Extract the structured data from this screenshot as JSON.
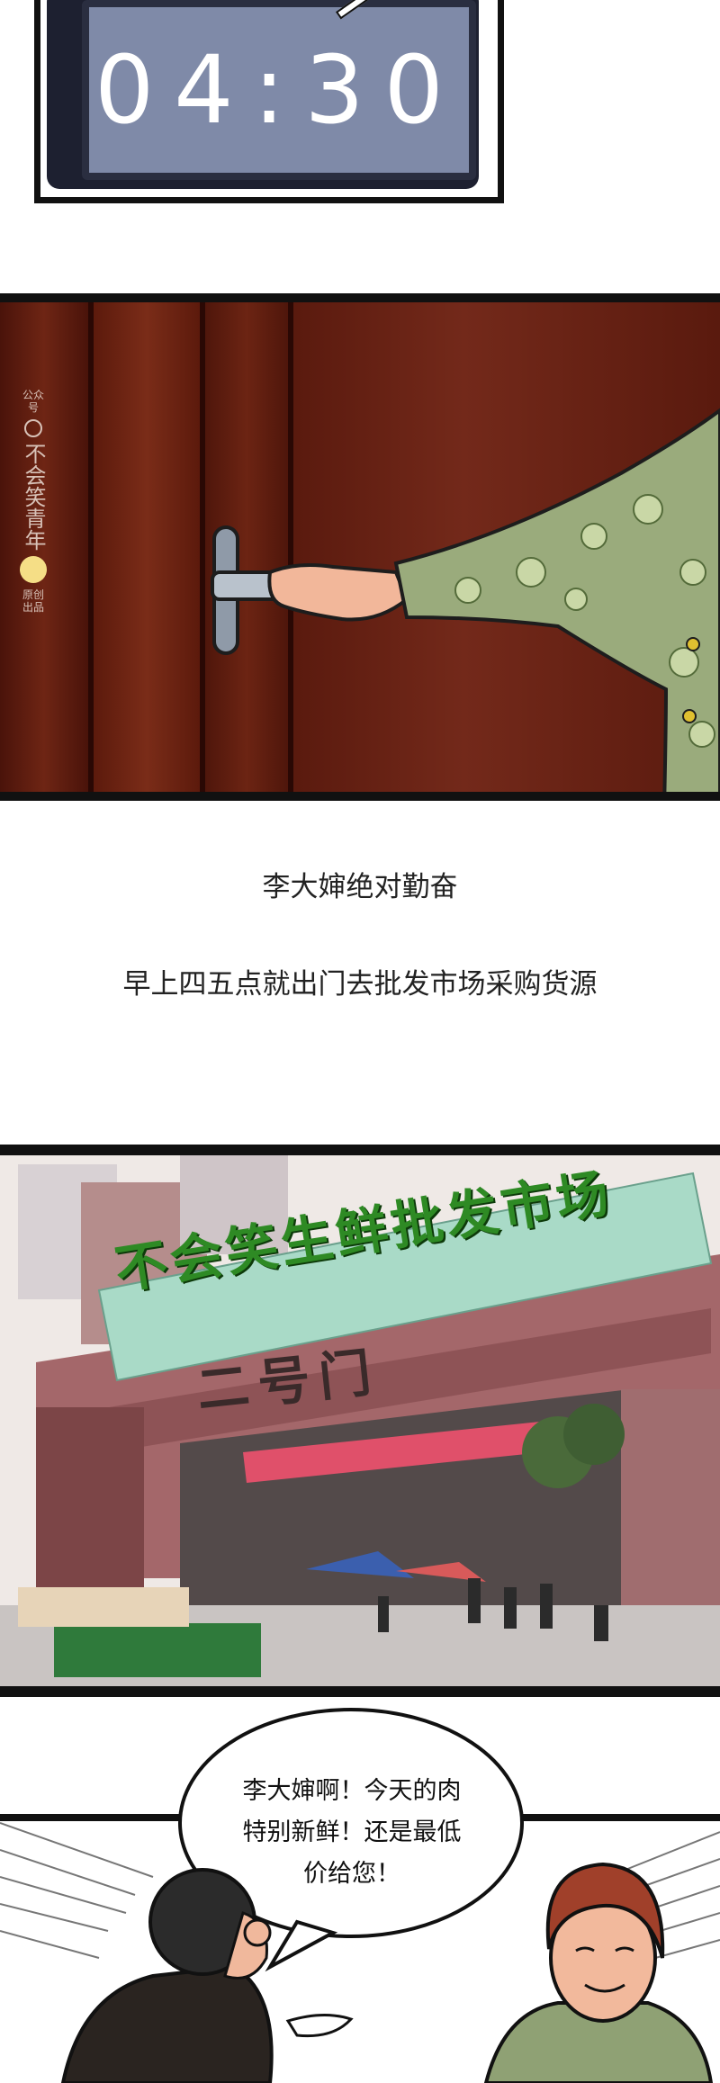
{
  "clock": {
    "time": "04:30"
  },
  "watermark": {
    "top_label": "公众号",
    "name": "不会笑青年",
    "bottom_label": "原创出品"
  },
  "narration": [
    "李大婶绝对勤奋",
    "早上四五点就出门去批发市场采购货源"
  ],
  "market": {
    "banner": "不会笑生鲜批发市场",
    "gate": "二号门"
  },
  "speech": {
    "lines": [
      "李大婶啊！今天的肉",
      "特别新鲜！还是最低",
      "价给您！"
    ]
  },
  "colors": {
    "door": "#5a1a0e",
    "clock_screen": "#7f8aa8",
    "banner_green": "#2e8a24",
    "sleeve": "#9aab7c"
  }
}
